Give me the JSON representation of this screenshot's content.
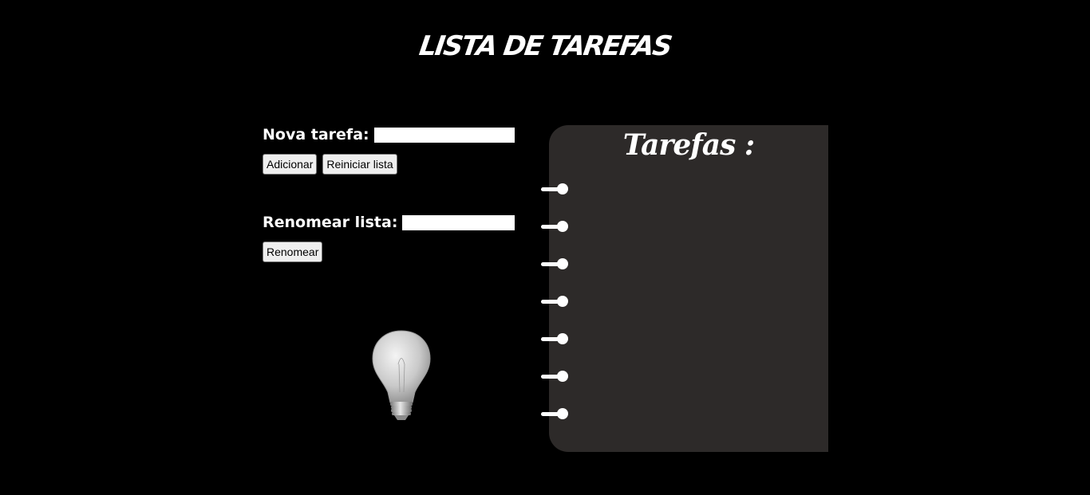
{
  "page": {
    "title": "LISTA DE TAREFAS"
  },
  "new_task": {
    "label": "Nova tarefa:",
    "input_value": "",
    "add_button": "Adicionar",
    "reset_button": "Reiniciar lista"
  },
  "rename_list": {
    "label": "Renomear lista:",
    "input_value": "",
    "rename_button": "Renomear"
  },
  "notebook": {
    "heading": "Tarefas :",
    "ring_count": 7,
    "tasks": []
  },
  "decor": {
    "bulb_icon": "lightbulb-icon",
    "ring_icon": "binder-ring-icon"
  },
  "colors": {
    "background": "#000000",
    "notebook": "#2d2a29",
    "text": "#ffffff"
  }
}
